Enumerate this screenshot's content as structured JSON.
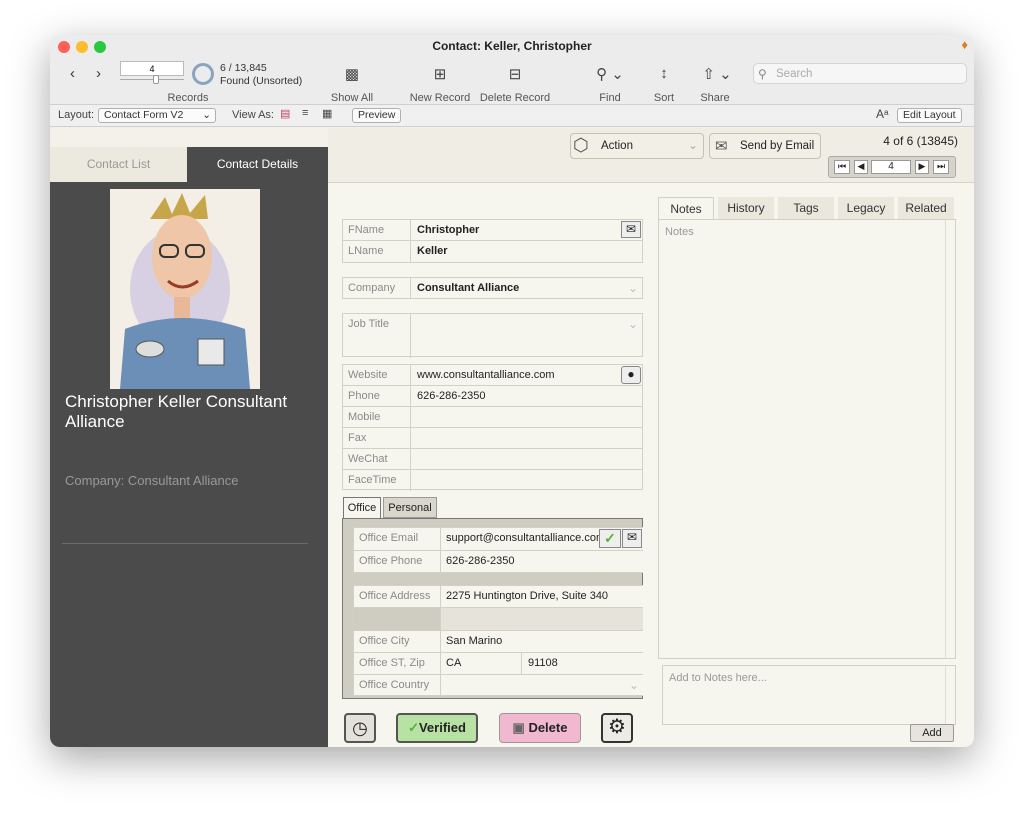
{
  "window": {
    "title": "Contact: Keller, Christopher"
  },
  "toolbar": {
    "record_input": "4",
    "record_count": "6 / 13,845",
    "found_status": "Found (Unsorted)",
    "records_label": "Records",
    "show_all": "Show All",
    "new_record": "New Record",
    "delete_record": "Delete Record",
    "find": "Find",
    "sort": "Sort",
    "share": "Share",
    "search_placeholder": "Search"
  },
  "layoutbar": {
    "layout_label": "Layout:",
    "layout_value": "Contact Form V2",
    "view_as_label": "View As:",
    "preview": "Preview",
    "font_icon_text": "Aᵃ",
    "edit_layout": "Edit Layout"
  },
  "sidebar": {
    "tabs": [
      {
        "label": "Contact List"
      },
      {
        "label": "Contact Details"
      }
    ],
    "name_company": "Christopher Keller Consultant Alliance",
    "company_line": "Company:  Consultant Alliance"
  },
  "header": {
    "action": "Action",
    "send_email": "Send by Email",
    "record_position": "4 of 6 (13845)",
    "nav_record": "4"
  },
  "fields": {
    "fname_label": "FName",
    "fname": "Christopher",
    "lname_label": "LName",
    "lname": "Keller",
    "company_label": "Company",
    "company": "Consultant Alliance",
    "job_title_label": "Job Title",
    "job_title": "",
    "website_label": "Website",
    "website": "www.consultantalliance.com",
    "phone_label": "Phone",
    "phone": "626-286-2350",
    "mobile_label": "Mobile",
    "fax_label": "Fax",
    "wechat_label": "WeChat",
    "facetime_label": "FaceTime"
  },
  "office": {
    "tabs": [
      {
        "label": "Office"
      },
      {
        "label": "Personal"
      }
    ],
    "email_label": "Office Email",
    "email": "support@consultantalliance.com",
    "phone_label": "Office Phone",
    "phone": "626-286-2350",
    "address_label": "Office Address",
    "address": "2275 Huntington Drive, Suite 340",
    "city_label": "Office City",
    "city": "San Marino",
    "stzip_label": "Office ST, Zip",
    "state": "CA",
    "zip": "91108",
    "country_label": "Office Country",
    "country": ""
  },
  "buttons": {
    "verified": "Verified",
    "delete": "Delete",
    "add": "Add"
  },
  "notes": {
    "tabs": [
      {
        "label": "Notes"
      },
      {
        "label": "History"
      },
      {
        "label": "Tags"
      },
      {
        "label": "Legacy"
      },
      {
        "label": "Related"
      }
    ],
    "notes_placeholder": "Notes",
    "add_placeholder": "Add to Notes here..."
  },
  "colors": {
    "left_panel": "#4b4b4b",
    "verified": "#b7e2a3",
    "delete": "#f2b8d0",
    "accent_green": "#58b030"
  }
}
